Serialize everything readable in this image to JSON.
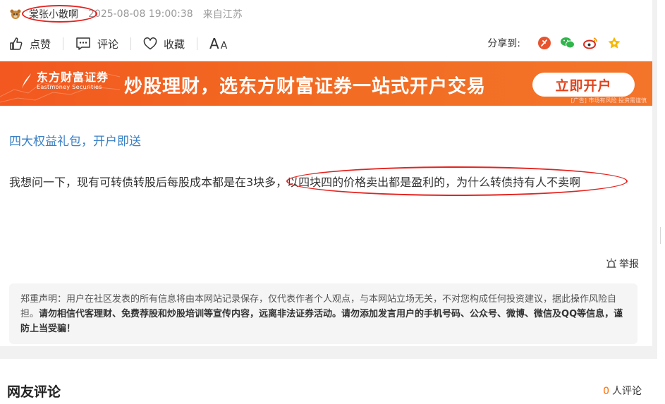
{
  "post": {
    "username": "棠张小散啊",
    "timestamp": "2025-08-08 19:00:38",
    "location": "来自江苏"
  },
  "actions": {
    "like": "点赞",
    "comment": "评论",
    "favorite": "收藏",
    "font_big": "A",
    "font_small": "A"
  },
  "share": {
    "label": "分享到:",
    "icons": [
      "weibo-tencent-icon",
      "wechat-icon",
      "sina-weibo-icon",
      "favorite-star-icon"
    ]
  },
  "banner": {
    "brand_name": "东方财富证券",
    "brand_en": "Eastmoney Securities",
    "slogan": "炒股理财，选东方财富证券一站式开户交易",
    "cta": "立即开户",
    "disclaimer": "[广告] 市场有风险 投资需谨慎"
  },
  "content": {
    "promo_link": "四大权益礼包，开户即送",
    "question": "我想问一下，现有可转债转股后每股成本都是在3块多，以四块四的价格卖出都是盈利的，为什么转债持有人不卖啊",
    "report": "举报"
  },
  "disclaimer": {
    "normal": "郑重声明：用户在社区发表的所有信息将由本网站记录保存，仅代表作者个人观点，与本网站立场无关，不对您构成任何投资建议，据此操作风险自担。",
    "bold": "请勿相信代客理财、免费荐股和炒股培训等宣传内容，远离非法证券活动。请勿添加发言用户的手机号码、公众号、微博、微信及QQ等信息，谨防上当受骗！"
  },
  "comments": {
    "title": "网友评论",
    "count": "0",
    "count_suffix": "人评论"
  },
  "colors": {
    "annotation": "#e4231f",
    "link": "#3a80c6",
    "banner": "#f2581f",
    "count": "#ff6a00"
  }
}
